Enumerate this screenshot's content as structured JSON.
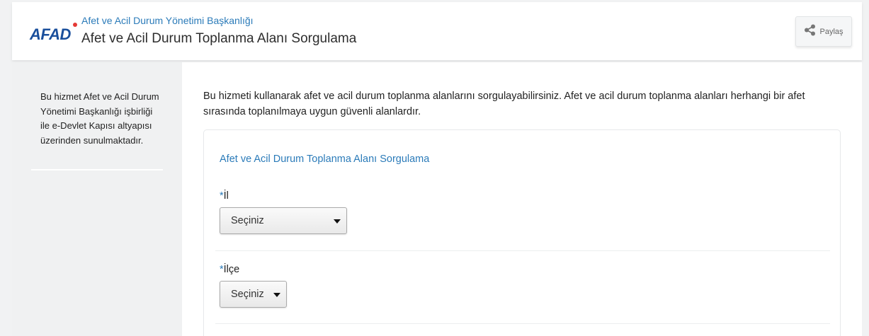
{
  "header": {
    "logo": "AFAD",
    "org_name": "Afet ve Acil Durum Yönetimi Başkanlığı",
    "title": "Afet ve Acil Durum Toplanma Alanı Sorgulama",
    "share_label": "Paylaş"
  },
  "sidebar": {
    "description": "Bu hizmet Afet ve Acil Durum Yönetimi Başkanlığı işbirliği ile e-Devlet Kapısı altyapısı üzerinden sunulmaktadır."
  },
  "main": {
    "intro": "Bu hizmeti kullanarak afet ve acil durum toplanma alanlarını sorgulayabilirsiniz. Afet ve acil durum toplanma alanları herhangi bir afet sırasında toplanılmaya uygun güvenli alanlardır.",
    "form": {
      "title": "Afet ve Acil Durum Toplanma Alanı Sorgulama",
      "required_mark": "*",
      "fields": [
        {
          "label": "İl",
          "value": "Seçiniz"
        },
        {
          "label": "İlçe",
          "value": "Seçiniz"
        }
      ]
    }
  },
  "colors": {
    "accent": "#2b7bb9",
    "logo": "#1a4f9c",
    "logo_dot": "#e53935"
  }
}
